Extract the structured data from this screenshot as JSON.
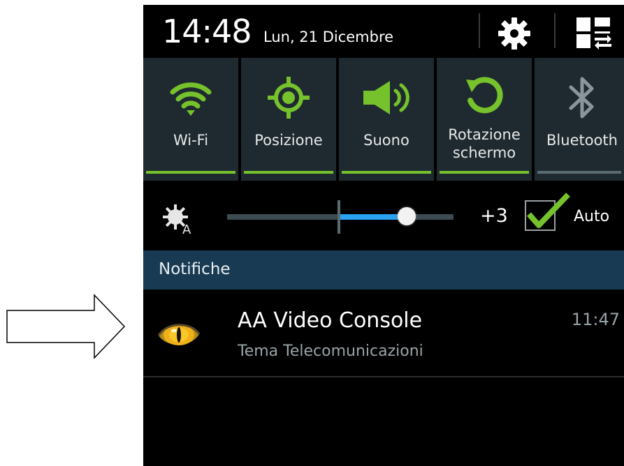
{
  "status": {
    "time": "14:48",
    "date": "Lun, 21 Dicembre",
    "settings_icon": "gear-icon",
    "toggle_view_icon": "grid-switch-icon"
  },
  "toggles": [
    {
      "label": "Wi-Fi",
      "icon": "wifi-icon",
      "on": true
    },
    {
      "label": "Posizione",
      "icon": "location-icon",
      "on": true
    },
    {
      "label": "Suono",
      "icon": "speaker-icon",
      "on": true
    },
    {
      "label_line1": "Rotazione",
      "label_line2": "schermo",
      "icon": "rotation-icon",
      "on": true
    },
    {
      "label": "Bluetooth",
      "icon": "bluetooth-icon",
      "on": false
    }
  ],
  "brightness": {
    "icon": "brightness-auto-icon",
    "value": "+3",
    "auto_label": "Auto",
    "auto_checked": true
  },
  "notifications": {
    "header": "Notifiche",
    "items": [
      {
        "title": "AA Video Console",
        "subtitle": "Tema Telecomunicazioni",
        "time": "11:47",
        "icon": "eye-app-icon"
      }
    ]
  },
  "colors": {
    "accent_green": "#76c22c",
    "slider_blue": "#29a2f0",
    "header_blue": "#183a52",
    "tile_bg": "#1e2a30"
  }
}
